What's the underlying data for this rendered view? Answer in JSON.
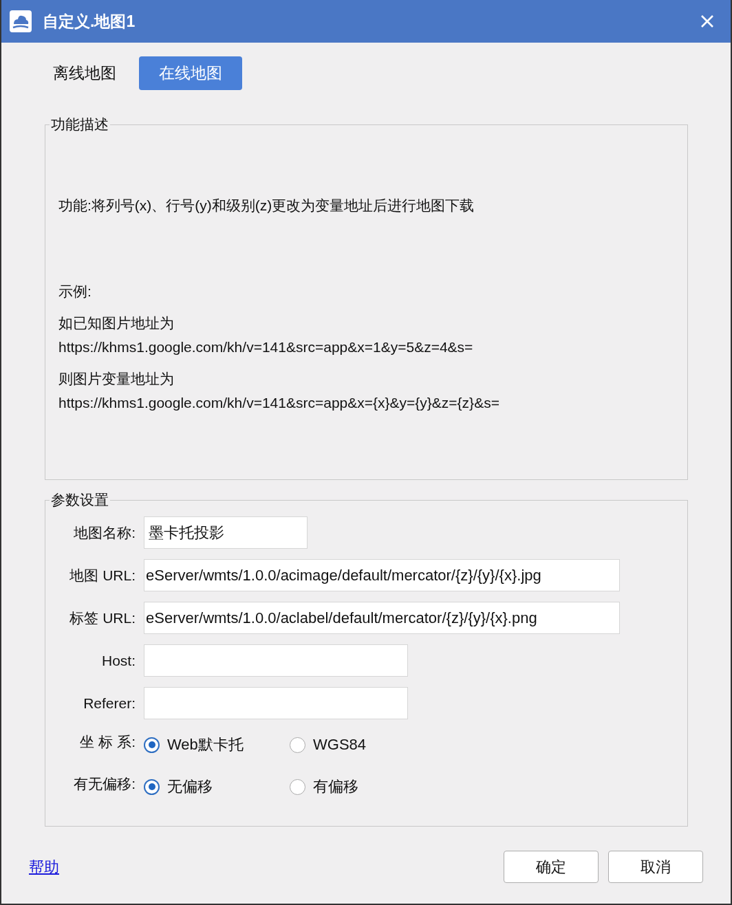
{
  "window": {
    "title": "自定义.地图1"
  },
  "tabs": [
    {
      "label": "离线地图",
      "selected": false
    },
    {
      "label": "在线地图",
      "selected": true
    }
  ],
  "description": {
    "title": "功能描述",
    "summary": "功能:将列号(x)、行号(y)和级别(z)更改为变量地址后进行地图下载",
    "example_heading": "示例:",
    "example_lines": [
      "如已知图片地址为",
      "https://khms1.google.com/kh/v=141&src=app&x=1&y=5&z=4&s=",
      "则图片变量地址为",
      "https://khms1.google.com/kh/v=141&src=app&x={x}&y={y}&z={z}&s="
    ]
  },
  "params": {
    "title": "参数设置",
    "fields": [
      {
        "label": "地图名称:",
        "value": "墨卡托投影",
        "kind": "short"
      },
      {
        "label": "地图 URL:",
        "value": "eServer/wmts/1.0.0/acimage/default/mercator/{z}/{y}/{x}.jpg",
        "kind": "long"
      },
      {
        "label": "标签 URL:",
        "value": "eServer/wmts/1.0.0/aclabel/default/mercator/{z}/{y}/{x}.png",
        "kind": "long"
      },
      {
        "label": "Host:",
        "kind": "medium"
      },
      {
        "label": "Referer:",
        "kind": "medium"
      }
    ],
    "options": [
      {
        "label": "坐 标 系:",
        "choices": [
          {
            "label": "Web默卡托",
            "selected": true
          },
          {
            "label": "WGS84",
            "selected": false
          }
        ]
      },
      {
        "label": "有无偏移:",
        "choices": [
          {
            "label": "无偏移",
            "selected": true
          },
          {
            "label": "有偏移",
            "selected": false
          }
        ]
      }
    ]
  },
  "footer": {
    "help_link": "帮助",
    "buttons": [
      "确定",
      "取消"
    ]
  }
}
